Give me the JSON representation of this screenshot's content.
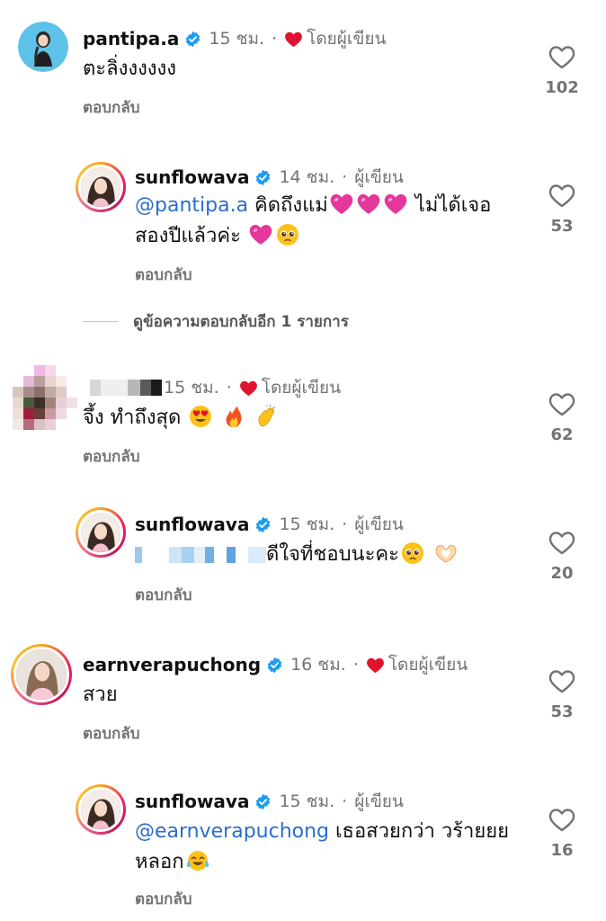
{
  "comments": [
    {
      "username": "pantipa.a",
      "time": "15 ชม.",
      "sep": "·",
      "liked_by": "โดยผู้เขียน",
      "text": "ตะลิ่งงงงงง",
      "reply": "ตอบกลับ",
      "likes": "102"
    },
    {
      "username": "sunflowava",
      "time": "14 ชม.",
      "sep": "·",
      "author_tag": "ผู้เขียน",
      "mention": "@pantipa.a",
      "text_a": " คิดถึงแม่",
      "text_b": " ไม่ได้เจอ",
      "text_c": "สองปีแล้วค่ะ",
      "reply": "ตอบกลับ",
      "likes": "53"
    },
    {
      "username": "",
      "time": "15 ชม.",
      "sep": "·",
      "liked_by": "โดยผู้เขียน",
      "text": "จึ้ง ทำถึงสุด",
      "reply": "ตอบกลับ",
      "likes": "62"
    },
    {
      "username": "sunflowava",
      "time": "15 ชม.",
      "sep": "·",
      "author_tag": "ผู้เขียน",
      "text": "ดีใจที่ชอบนะคะ",
      "reply": "ตอบกลับ",
      "likes": "20"
    },
    {
      "username": "earnverapuchong",
      "time": "16 ชม.",
      "sep": "·",
      "liked_by": "โดยผู้เขียน",
      "text": "สวย",
      "reply": "ตอบกลับ",
      "likes": "53"
    },
    {
      "username": "sunflowava",
      "time": "15 ชม.",
      "sep": "·",
      "author_tag": "ผู้เขียน",
      "mention": "@earnverapuchong",
      "text_a": " เธอสวยกว่า วร้ายยย",
      "text_b": "หลอก",
      "reply": "ตอบกลับ",
      "likes": "16"
    }
  ],
  "view_more_replies": "ดูข้อความตอบกลับอีก 1 รายการ",
  "colors": {
    "mention": "#2a6ec9",
    "verified": "#1d9bf0",
    "heart_red": "#e0132e",
    "muted": "#737373"
  },
  "icons": [
    "verified-badge-icon",
    "red-heart-icon",
    "like-heart-outline-icon",
    "pink-heart-emoji",
    "pleading-face-emoji",
    "heart-eyes-emoji",
    "fire-emoji",
    "clapping-hands-emoji",
    "heart-hands-emoji",
    "tears-of-joy-emoji"
  ]
}
